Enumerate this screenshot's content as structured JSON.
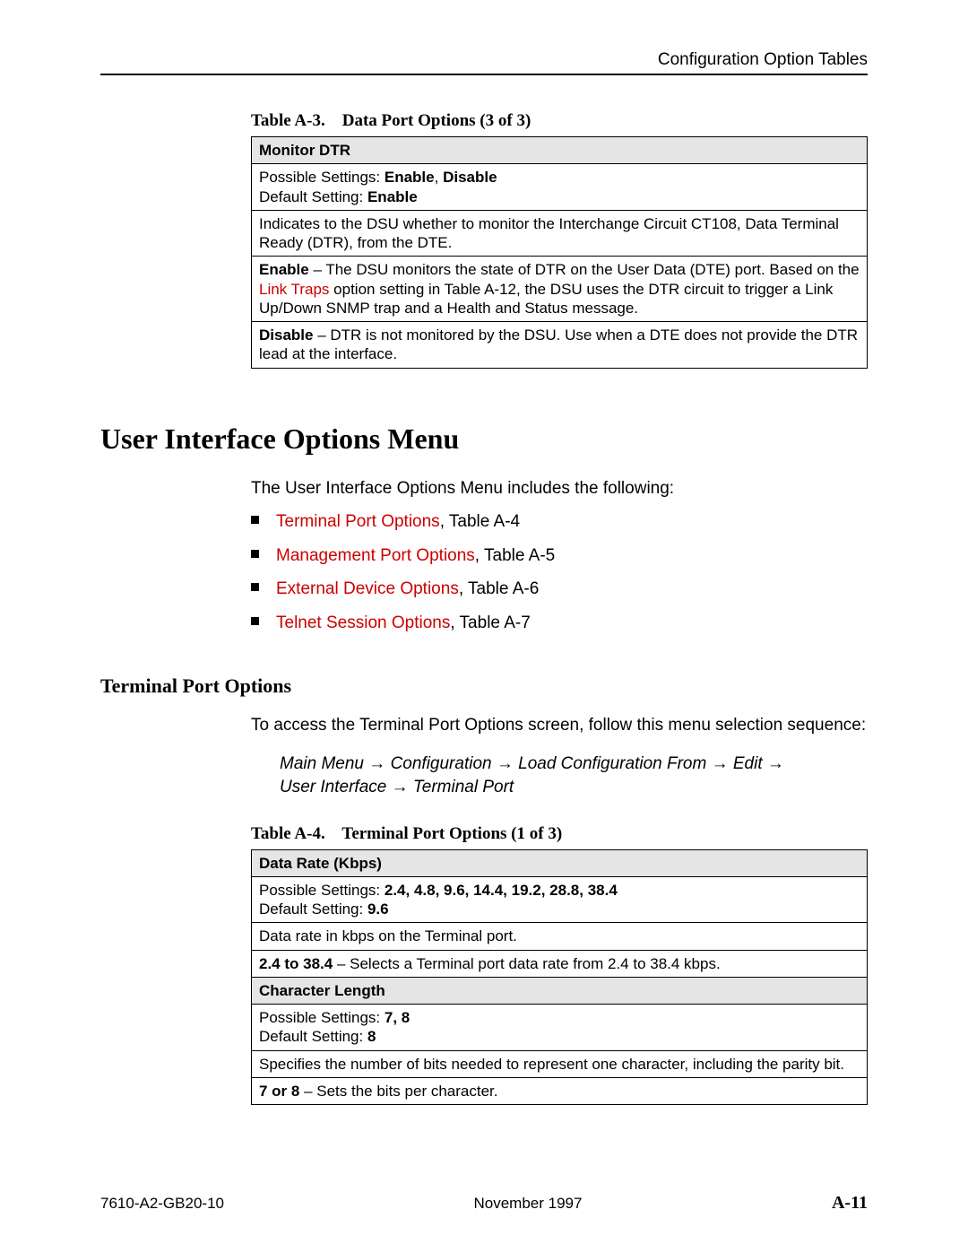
{
  "header": {
    "running": "Configuration Option Tables"
  },
  "tableA3": {
    "caption_prefix": "Table A-3.",
    "caption_title": "Data Port Options (3 of 3)",
    "rows": {
      "r0": "Monitor DTR",
      "r1_possible_lbl": "Possible Settings: ",
      "r1_possible_val": "Enable",
      "r1_possible_sep": ", ",
      "r1_possible_val2": "Disable",
      "r1_default_lbl": "Default Setting: ",
      "r1_default_val": "Enable",
      "r2": "Indicates to the DSU whether to monitor the Interchange Circuit CT108, Data Terminal Ready (DTR), from the DTE.",
      "r3_lead": "Enable",
      "r3_pre": " – The DSU monitors the state of DTR on the User Data (DTE) port. Based on the ",
      "r3_link": "Link Traps",
      "r3_post": " option setting in Table A-12, the DSU uses the DTR circuit to trigger a Link Up/Down SNMP trap and a Health and Status message.",
      "r4_lead": "Disable",
      "r4_rest": " – DTR is not monitored by the DSU. Use when a DTE does not provide the DTR lead at the interface."
    }
  },
  "section": {
    "h1": "User Interface Options Menu",
    "intro": "The User Interface Options Menu includes the following:",
    "items": [
      {
        "link": "Terminal Port Options",
        "suffix": ", Table A-4"
      },
      {
        "link": "Management Port Options",
        "suffix": ", Table A-5"
      },
      {
        "link": "External Device Options",
        "suffix": ", Table A-6"
      },
      {
        "link": "Telnet Session Options",
        "suffix": ", Table A-7"
      }
    ]
  },
  "subsection": {
    "h2": "Terminal Port Options",
    "intro": "To access the Terminal Port Options screen, follow this menu selection sequence:",
    "path_line1_a": "Main Menu ",
    "path_line1_b": "Configuration ",
    "path_line1_c": "Load Configuration From ",
    "path_line1_d": "Edit ",
    "path_line2_a": "User Interface ",
    "path_line2_b": "Terminal Port"
  },
  "tableA4": {
    "caption_prefix": "Table A-4.",
    "caption_title": "Terminal Port Options (1 of 3)",
    "rows": {
      "r0": "Data Rate (Kbps)",
      "r1_possible_lbl": "Possible Settings: ",
      "r1_possible_val": "2.4, 4.8, 9.6, 14.4, 19.2, 28.8, 38.4",
      "r1_default_lbl": "Default Setting: ",
      "r1_default_val": "9.6",
      "r2": "Data rate in kbps on the Terminal port.",
      "r3_lead": "2.4 to 38.4",
      "r3_rest": " – Selects a Terminal port data rate from 2.4 to 38.4 kbps.",
      "r4": "Character Length",
      "r5_possible_lbl": "Possible Settings: ",
      "r5_possible_val": "7, 8",
      "r5_default_lbl": "Default Setting: ",
      "r5_default_val": "8",
      "r6": "Specifies the number of bits needed to represent one character, including the parity bit.",
      "r7_lead": "7 or 8",
      "r7_rest": " – Sets the bits per character."
    }
  },
  "footer": {
    "doc": "7610-A2-GB20-10",
    "date": "November 1997",
    "page": "A-11"
  }
}
